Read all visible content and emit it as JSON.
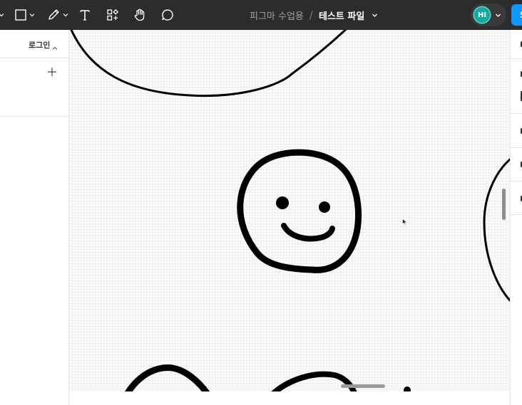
{
  "toolbar": {
    "project_name": "피그마 수업용",
    "separator": "/",
    "file_name": "테스트 파일",
    "user_initials": "HI",
    "share_label": "S",
    "tools": [
      {
        "name": "frame-tool",
        "icon": "frame-icon"
      },
      {
        "name": "shape-tool",
        "icon": "rectangle-icon"
      },
      {
        "name": "pen-tool",
        "icon": "pen-icon"
      },
      {
        "name": "text-tool",
        "icon": "text-icon"
      },
      {
        "name": "resources-tool",
        "icon": "resources-icon"
      },
      {
        "name": "hand-tool",
        "icon": "hand-icon"
      },
      {
        "name": "comment-tool",
        "icon": "comment-icon"
      }
    ]
  },
  "left_panel": {
    "section_label": "로그인",
    "add_icon": "plus-icon"
  },
  "colors": {
    "toolbar_bg": "#2c2c2c",
    "accent": "#0d99ff",
    "avatar": "#17a8a0",
    "stroke": "#000000"
  }
}
